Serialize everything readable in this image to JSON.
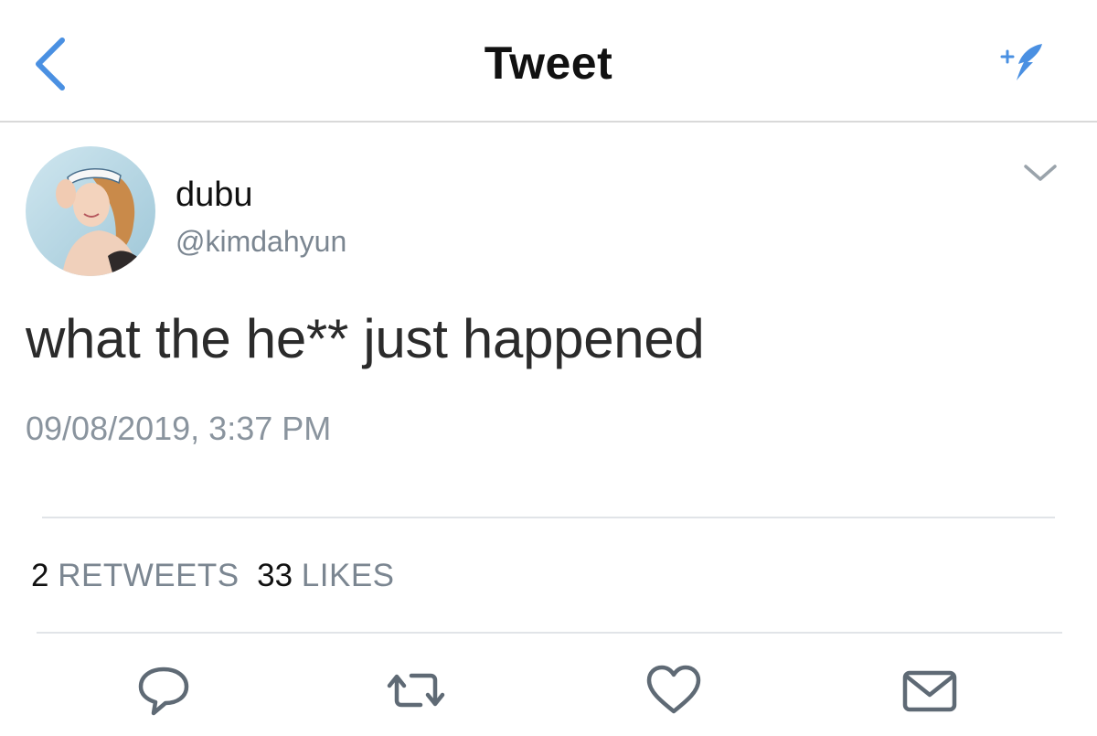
{
  "navbar": {
    "title": "Tweet",
    "back_icon": "chevron-left-icon",
    "compose_icon": "compose-feather-icon",
    "accent_color": "#4a90e2"
  },
  "tweet": {
    "author": {
      "display_name": "dubu",
      "handle": "@kimdahyun",
      "avatar": "profile-photo"
    },
    "text": "what the he** just happened",
    "timestamp": "09/08/2019, 3:37 PM",
    "menu_icon": "chevron-down-icon"
  },
  "stats": {
    "retweets_count": "2",
    "retweets_label": "RETWEETS",
    "likes_count": "33",
    "likes_label": "LIKES"
  },
  "actions": [
    {
      "icon": "reply-icon"
    },
    {
      "icon": "retweet-icon"
    },
    {
      "icon": "like-heart-icon"
    },
    {
      "icon": "share-mail-icon"
    }
  ],
  "colors": {
    "text_primary": "#111111",
    "text_secondary": "#7b8691",
    "icon_gray": "#5f6a75",
    "divider": "#e1e4e8"
  }
}
